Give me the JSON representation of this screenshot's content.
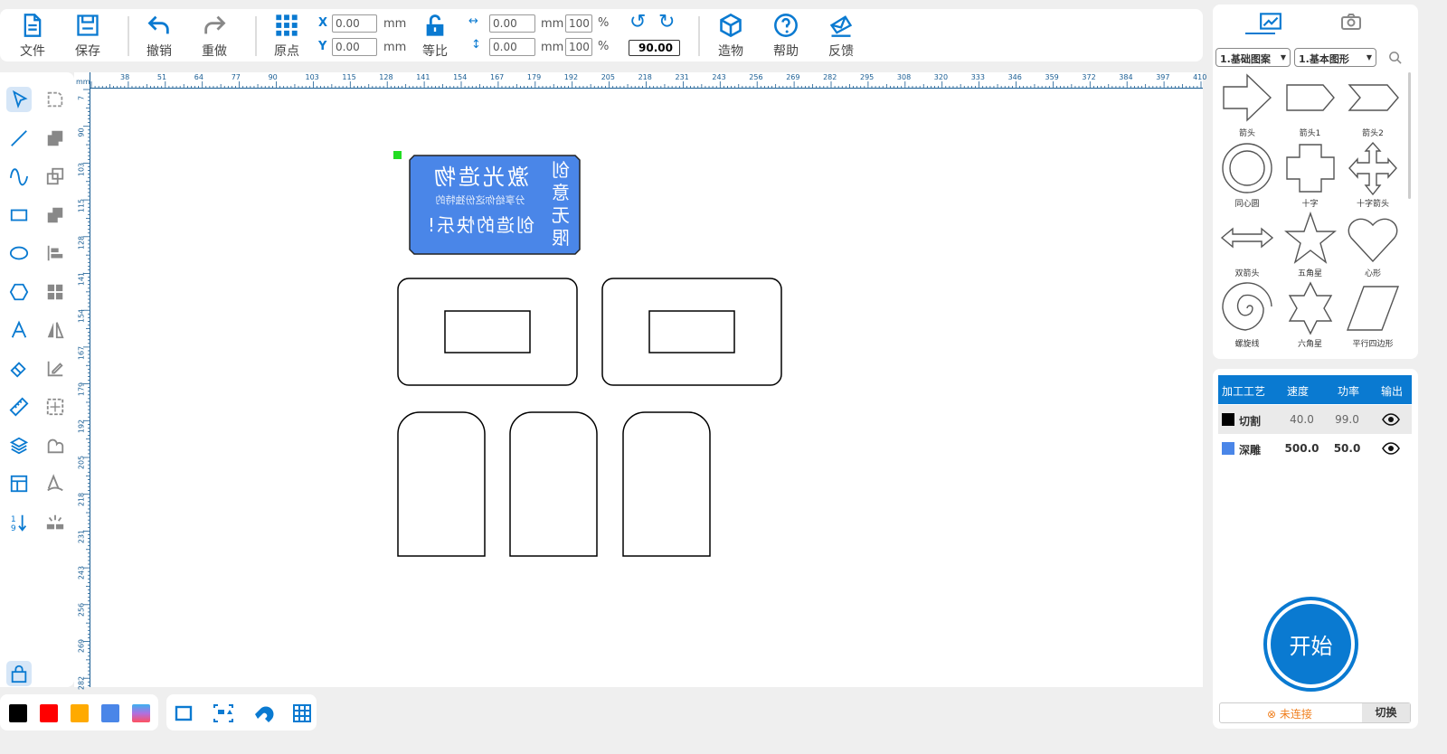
{
  "toolbar": {
    "file": "文件",
    "save": "保存",
    "undo": "撤销",
    "redo": "重做",
    "origin": "原点",
    "x_label": "X",
    "x_value": "0.00",
    "y_label": "Y",
    "y_value": "0.00",
    "unit": "mm",
    "ratio": "等比",
    "w_value": "0.00",
    "h_value": "0.00",
    "w_pct": "100",
    "h_pct": "100",
    "pct": "%",
    "rotate_value": "90.00",
    "make": "造物",
    "help": "帮助",
    "feedback": "反馈"
  },
  "ruler": {
    "unit": "mm",
    "top": [
      "38",
      "51",
      "64",
      "77",
      "90",
      "103",
      "115",
      "128",
      "141",
      "154",
      "167",
      "179",
      "192",
      "205",
      "218",
      "231",
      "243",
      "256",
      "269",
      "282",
      "295",
      "308",
      "320",
      "333",
      "346",
      "359",
      "372",
      "384",
      "397",
      "410"
    ],
    "left": [
      "7",
      "90",
      "103",
      "115",
      "128",
      "141",
      "154",
      "167",
      "179",
      "192",
      "205",
      "218",
      "231",
      "243",
      "256",
      "269",
      "282"
    ]
  },
  "canvas": {
    "plate": {
      "title": "激光造物",
      "subtitle": "分享给你这份独特的",
      "line3": "创造的快乐!",
      "side": "创意无限",
      "color": "#4a86e8"
    }
  },
  "right": {
    "dropdown1": "1.基础图案",
    "dropdown2": "1.基本图形",
    "shapes": [
      "箭头",
      "箭头1",
      "箭头2",
      "同心圆",
      "十字",
      "十字箭头",
      "双箭头",
      "五角星",
      "心形",
      "螺旋线",
      "六角星",
      "平行四边形"
    ]
  },
  "layers": {
    "headers": [
      "加工工艺",
      "速度",
      "功率",
      "输出"
    ],
    "rows": [
      {
        "color": "#000000",
        "name": "切割",
        "speed": "40.0",
        "power": "99.0"
      },
      {
        "color": "#4a86e8",
        "name": "深雕",
        "speed": "500.0",
        "power": "50.0"
      }
    ]
  },
  "start": "开始",
  "status": "未连接",
  "switch": "切换",
  "colors": [
    "#000000",
    "#ff0000",
    "#ffaa00",
    "#4a86e8",
    "gradient"
  ],
  "accent": "#0a7ad1"
}
